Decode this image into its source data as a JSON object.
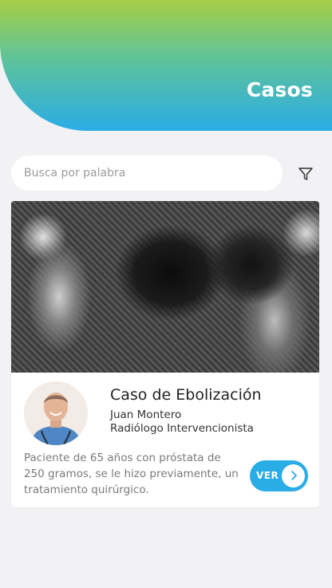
{
  "header": {
    "title": "Casos",
    "gradient_colors": [
      "#a6cf46",
      "#5fc39a",
      "#2aace6"
    ]
  },
  "search": {
    "placeholder": "Busca por palabra",
    "value": ""
  },
  "filter": {
    "icon": "filter-icon"
  },
  "cases": [
    {
      "image": "mri-scan-image",
      "title": "Caso de Ebolización",
      "author_name": "Juan Montero",
      "author_role": "Radiólogo Intervencionista",
      "description": "Paciente de 65 años con próstata de 250 gramos, se le hizo previamente, un tratamiento quirúrgico.",
      "button_label": "VER",
      "button_icon": "chevron-right-icon",
      "accent_color": "#2aace6"
    }
  ]
}
